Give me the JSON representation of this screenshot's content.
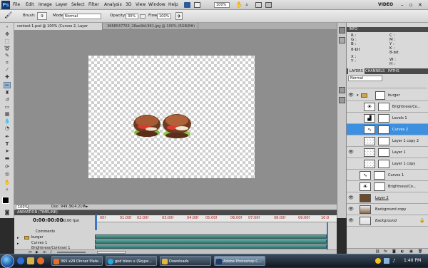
{
  "menubar": {
    "logo": "Ps",
    "items": [
      "File",
      "Edit",
      "Image",
      "Layer",
      "Select",
      "Filter",
      "Analysis",
      "3D",
      "View",
      "Window",
      "Help"
    ],
    "zoom": "100%",
    "workspace": "VIDEO"
  },
  "options": {
    "brush_label": "Brush:",
    "brush_size": "9",
    "mode_label": "Mode:",
    "mode_value": "Normal",
    "opacity_label": "Opacity:",
    "opacity_value": "30%",
    "flow_label": "Flow:",
    "flow_value": "100%"
  },
  "tabs": [
    {
      "label": "contest 1.psd @ 100% (Curves 2, Layer Mask/8) *"
    },
    {
      "label": "3668547763_28ae9b1961.jpg @ 100% (RGB/8#)"
    }
  ],
  "status": {
    "zoom": "100%",
    "doc": "Doc: 949.3K/4.21M"
  },
  "animation": {
    "title": "ANIMATION (TIMELINE)",
    "timecode": "0:00:00:00",
    "fps": "(30.00 fps)",
    "ruler": [
      "00f",
      "01:00f",
      "02:00f",
      "03:00f",
      "04:00f",
      "05:00f",
      "06:00f",
      "07:00f",
      "08:00f",
      "09:00f",
      "10:0"
    ],
    "tracks": [
      "Comments",
      "burger",
      "Curves 1",
      "Brightness/Contrast 1"
    ]
  },
  "info_panel": {
    "title": "INFO",
    "lines": [
      "R :",
      "G :",
      "B :",
      "8-bit",
      "X :",
      "Y :",
      "C :",
      "M :",
      "Y :",
      "K :",
      "8-bit",
      "W :",
      "H :"
    ]
  },
  "layers_panel": {
    "tabs": [
      "LAYERS",
      "CHANNELS",
      "PATHS"
    ],
    "blend_mode": "Normal",
    "layers": [
      {
        "name": "burger",
        "visible": true,
        "type": "group"
      },
      {
        "name": "Brightness/Co...",
        "visible": false,
        "type": "adjust"
      },
      {
        "name": "Levels 1",
        "visible": false,
        "type": "adjust"
      },
      {
        "name": "Curves 2",
        "visible": false,
        "type": "adjust",
        "selected": true
      },
      {
        "name": "Layer 1 copy 2",
        "visible": false,
        "type": "pixel"
      },
      {
        "name": "Layer 1",
        "visible": true,
        "type": "pixel"
      },
      {
        "name": "Layer 1 copy",
        "visible": false,
        "type": "pixel"
      },
      {
        "name": "Curves 1",
        "visible": false,
        "type": "adjust"
      },
      {
        "name": "Brightness/Co...",
        "visible": false,
        "type": "adjust"
      },
      {
        "name": "Layer 2",
        "visible": true,
        "type": "pixel"
      },
      {
        "name": "Background copy",
        "visible": true,
        "type": "pixel"
      },
      {
        "name": "Background",
        "visible": true,
        "type": "pixel"
      }
    ]
  },
  "taskbar": {
    "tasks": [
      {
        "label": "365 x29 Dinner Plate..."
      },
      {
        "label": "god bless u (Skype..."
      },
      {
        "label": "Downloads"
      },
      {
        "label": "Adobe Photoshop C..."
      }
    ],
    "clock": "1:40 PM"
  }
}
